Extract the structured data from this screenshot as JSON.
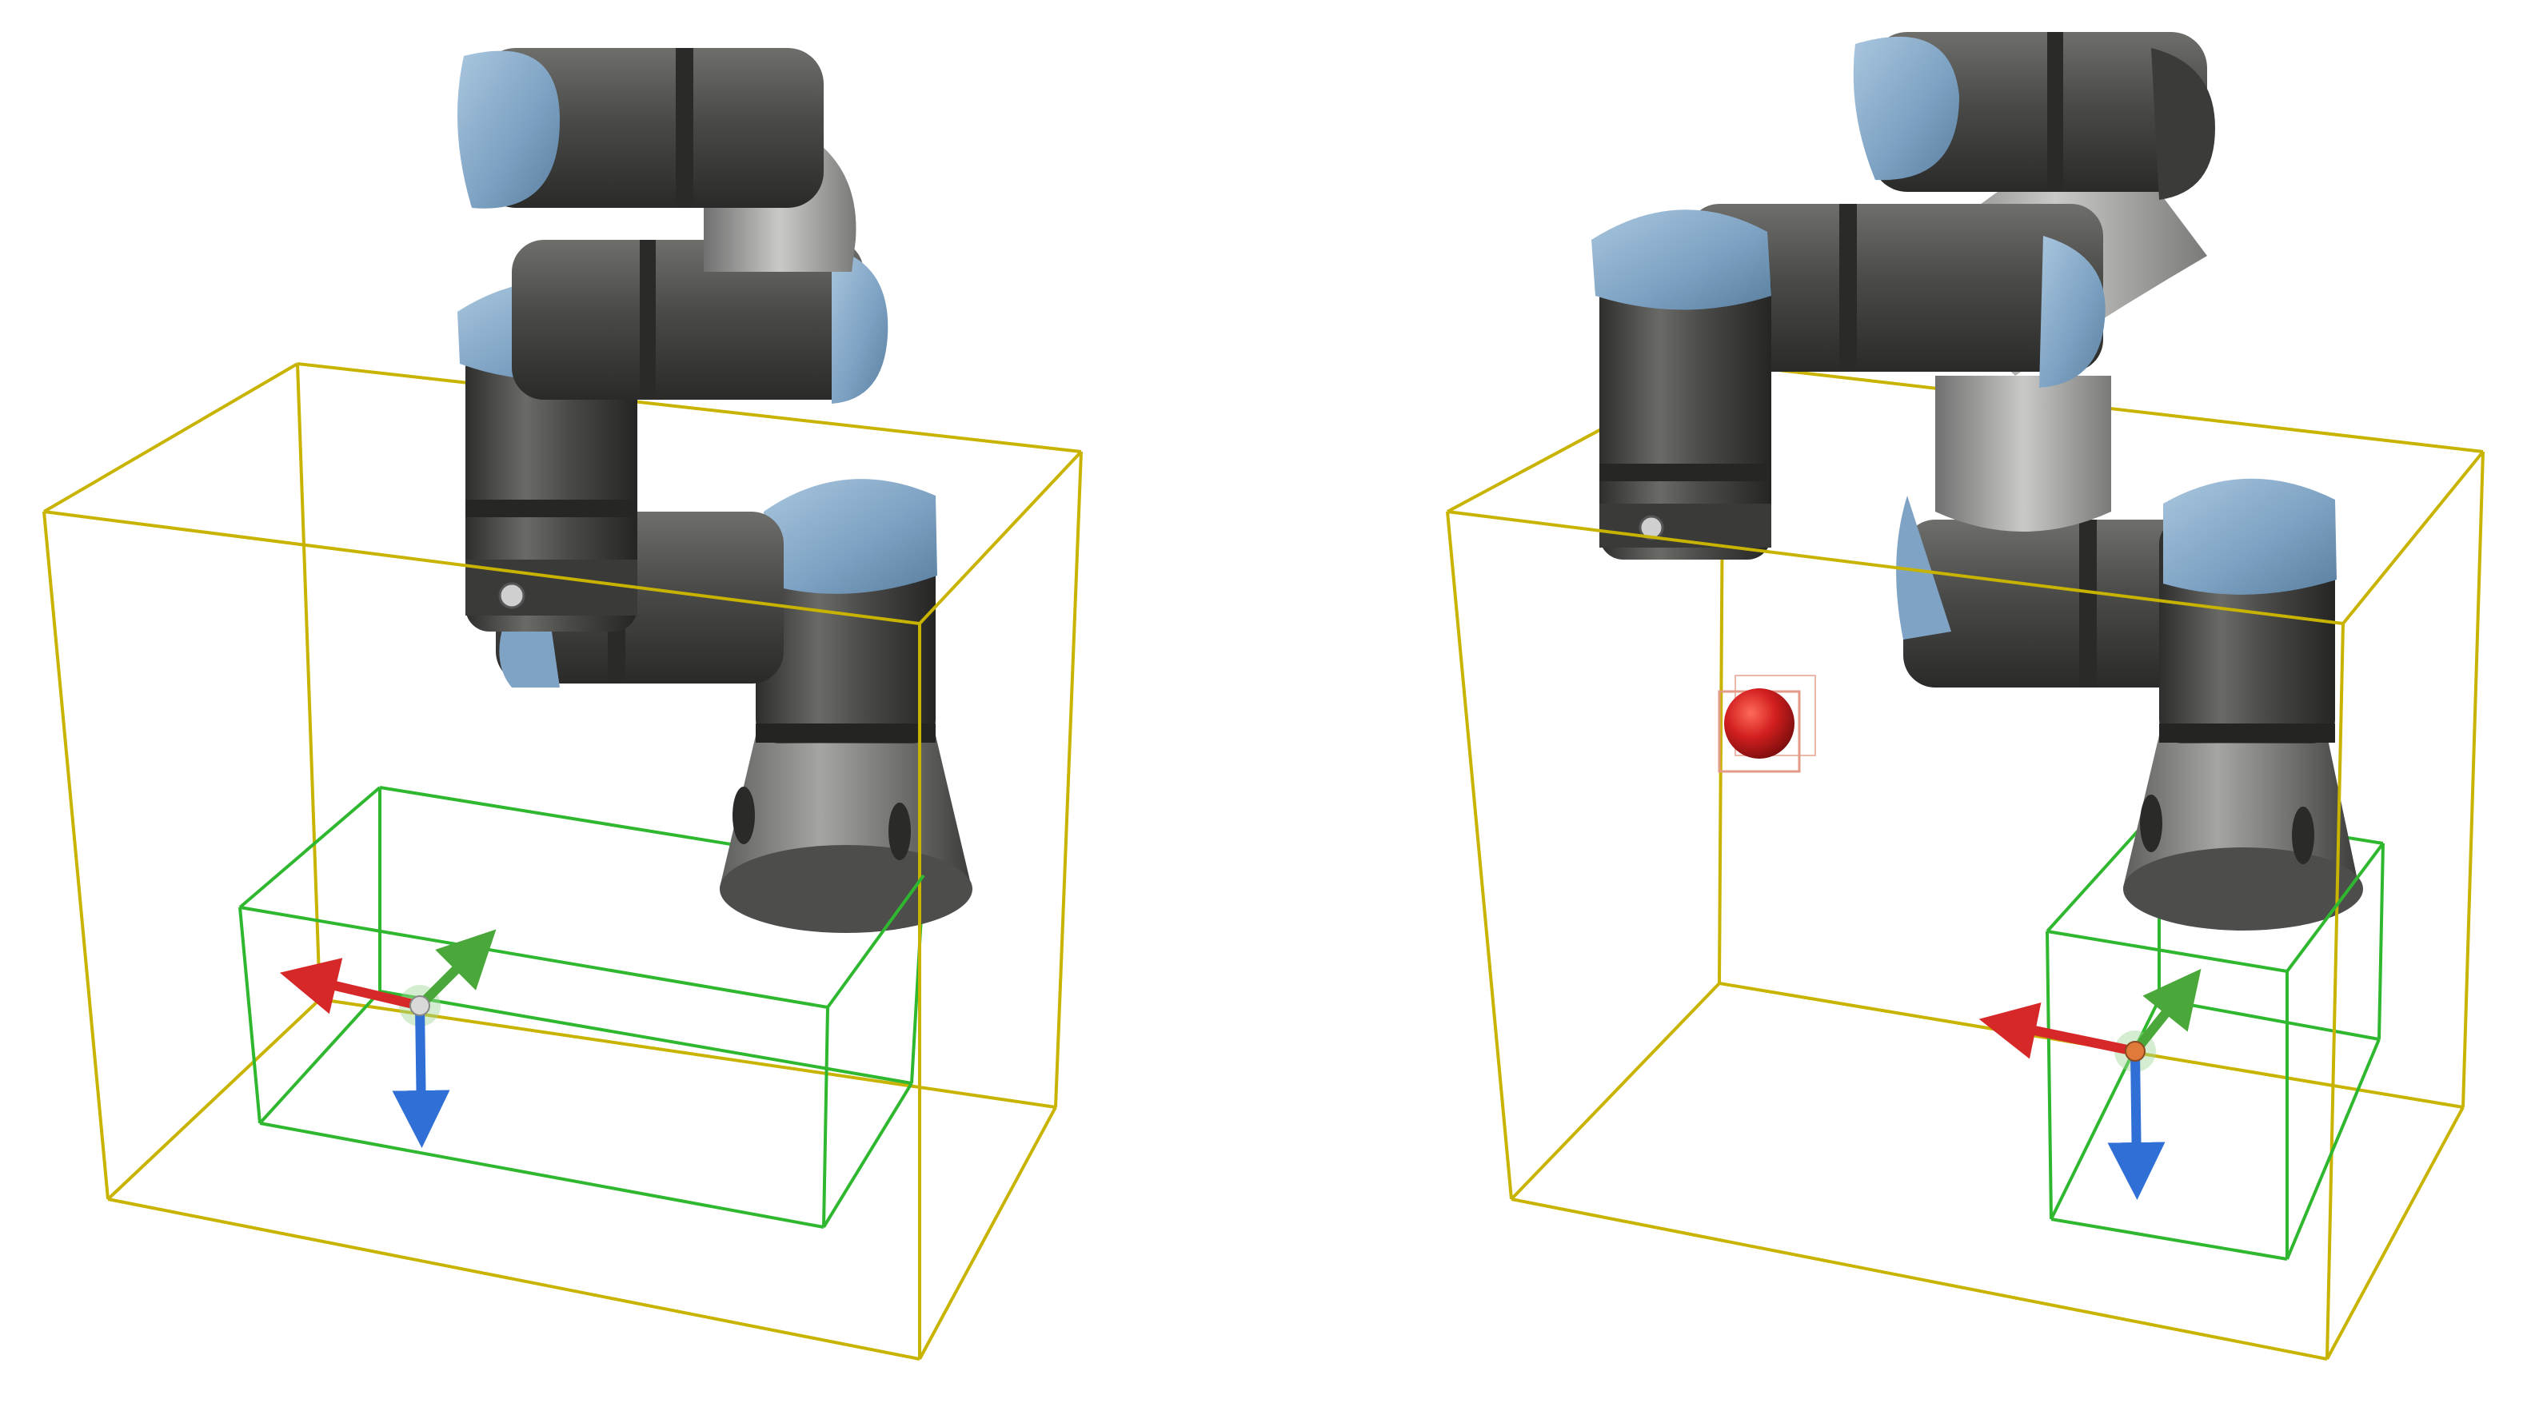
{
  "scenes": [
    {
      "name": "left-robot-scene",
      "has_target_sphere": false
    },
    {
      "name": "right-robot-scene",
      "has_target_sphere": true
    }
  ],
  "colors": {
    "background": "#ffffff",
    "workspace_box": "#c8b400",
    "target_box": "#2fb82f",
    "robot_body": "#4a4a48",
    "robot_light": "#9a9a98",
    "robot_cap": "#7fa3c4",
    "axis_x": "#d62828",
    "axis_y": "#4aa83a",
    "axis_z": "#2f6fd6",
    "sphere": "#d21f1f"
  },
  "icons": {
    "axes": "xyz-axes-gizmo-icon",
    "sphere": "red-sphere-icon"
  }
}
